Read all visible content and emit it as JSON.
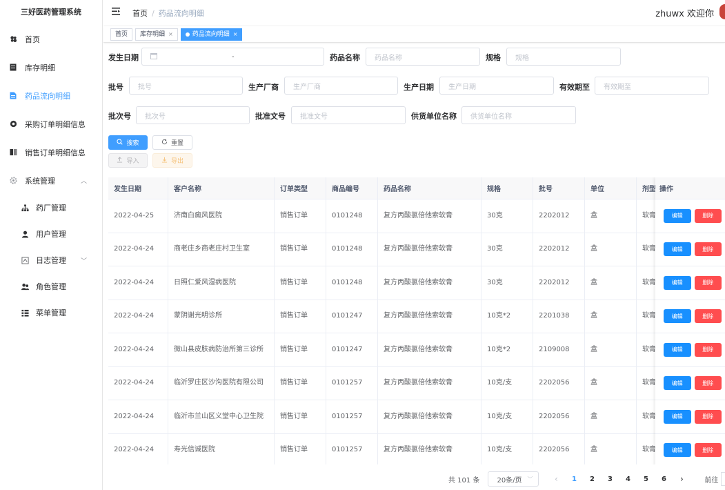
{
  "app": {
    "title": "三好医药管理系统"
  },
  "sidebar": {
    "items": [
      {
        "label": "首页",
        "icon": "dashboard-icon"
      },
      {
        "label": "库存明细",
        "icon": "inventory-icon"
      },
      {
        "label": "药品流向明细",
        "icon": "document-icon",
        "active": true
      },
      {
        "label": "采购订单明细信息",
        "icon": "purchase-icon"
      },
      {
        "label": "销售订单明细信息",
        "icon": "sales-icon"
      },
      {
        "label": "系统管理",
        "icon": "gear-icon",
        "expanded": true
      }
    ],
    "sub_items": [
      {
        "label": "药厂管理",
        "icon": "org-tree-icon"
      },
      {
        "label": "用户管理",
        "icon": "user-icon"
      },
      {
        "label": "日志管理",
        "icon": "log-icon"
      },
      {
        "label": "角色管理",
        "icon": "role-icon"
      },
      {
        "label": "菜单管理",
        "icon": "menu-list-icon"
      }
    ]
  },
  "header": {
    "breadcrumb_home": "首页",
    "breadcrumb_sep": "/",
    "breadcrumb_current": "药品流向明细",
    "welcome": "zhuwx 欢迎你"
  },
  "tags": [
    {
      "label": "首页"
    },
    {
      "label": "库存明细",
      "close": "×"
    },
    {
      "label": "药品流向明细",
      "close": "×",
      "active": true
    }
  ],
  "form": {
    "occur_date_label": "发生日期",
    "occur_date_sep": "-",
    "drug_name_label": "药品名称",
    "drug_name_placeholder": "药品名称",
    "spec_label": "规格",
    "spec_placeholder": "规格",
    "batch_label": "批号",
    "batch_placeholder": "批号",
    "manufacturer_label": "生产厂商",
    "manufacturer_placeholder": "生产厂商",
    "prod_date_label": "生产日期",
    "prod_date_placeholder": "生产日期",
    "expiry_label": "有效期至",
    "expiry_placeholder": "有效期至",
    "lot_label": "批次号",
    "lot_placeholder": "批次号",
    "approval_label": "批准文号",
    "approval_placeholder": "批准文号",
    "supplier_label": "供货单位名称",
    "supplier_placeholder": "供货单位名称"
  },
  "buttons": {
    "search": "搜索",
    "reset": "重置",
    "import": "导入",
    "export": "导出"
  },
  "table": {
    "columns": [
      "发生日期",
      "客户名称",
      "订单类型",
      "商品编号",
      "药品名称",
      "规格",
      "批号",
      "单位",
      "剂型"
    ],
    "ops_header": "操作",
    "edit_label": "编辑",
    "delete_label": "删除",
    "rows": [
      [
        "2022-04-25",
        "济南白癜风医院",
        "销售订单",
        "0101248",
        "复方丙酸氯倍他索软膏",
        "30克",
        "2202012",
        "盒",
        "软膏"
      ],
      [
        "2022-04-24",
        "商老庄乡商老庄村卫生室",
        "销售订单",
        "0101248",
        "复方丙酸氯倍他索软膏",
        "30克",
        "2202012",
        "盒",
        "软膏"
      ],
      [
        "2022-04-24",
        "日照仁爱风湿病医院",
        "销售订单",
        "0101248",
        "复方丙酸氯倍他索软膏",
        "30克",
        "2202012",
        "盒",
        "软膏"
      ],
      [
        "2022-04-24",
        "蒙阴谢光明诊所",
        "销售订单",
        "0101247",
        "复方丙酸氯倍他索软膏",
        "10克*2",
        "2201038",
        "盒",
        "软膏"
      ],
      [
        "2022-04-24",
        "微山县皮肤病防治所第三诊所",
        "销售订单",
        "0101247",
        "复方丙酸氯倍他索软膏",
        "10克*2",
        "2109008",
        "盒",
        "软膏"
      ],
      [
        "2022-04-24",
        "临沂罗庄区沙沟医院有限公司",
        "销售订单",
        "0101257",
        "复方丙酸氯倍他索软膏",
        "10克/支",
        "2202056",
        "盒",
        "软膏"
      ],
      [
        "2022-04-24",
        "临沂市兰山区义堂中心卫生院",
        "销售订单",
        "0101257",
        "复方丙酸氯倍他索软膏",
        "10克/支",
        "2202056",
        "盒",
        "软膏"
      ],
      [
        "2022-04-24",
        "寿光信诚医院",
        "销售订单",
        "0101257",
        "复方丙酸氯倍他索软膏",
        "10克/支",
        "2202056",
        "盒",
        "软膏"
      ]
    ]
  },
  "pagination": {
    "total": "共 101 条",
    "page_size": "20条/页",
    "pages": [
      "1",
      "2",
      "3",
      "4",
      "5",
      "6"
    ],
    "current": "1",
    "goto": "前往"
  },
  "colors": {
    "primary": "#409eff",
    "danger": "#ff4d4f",
    "edit": "#1890ff"
  }
}
